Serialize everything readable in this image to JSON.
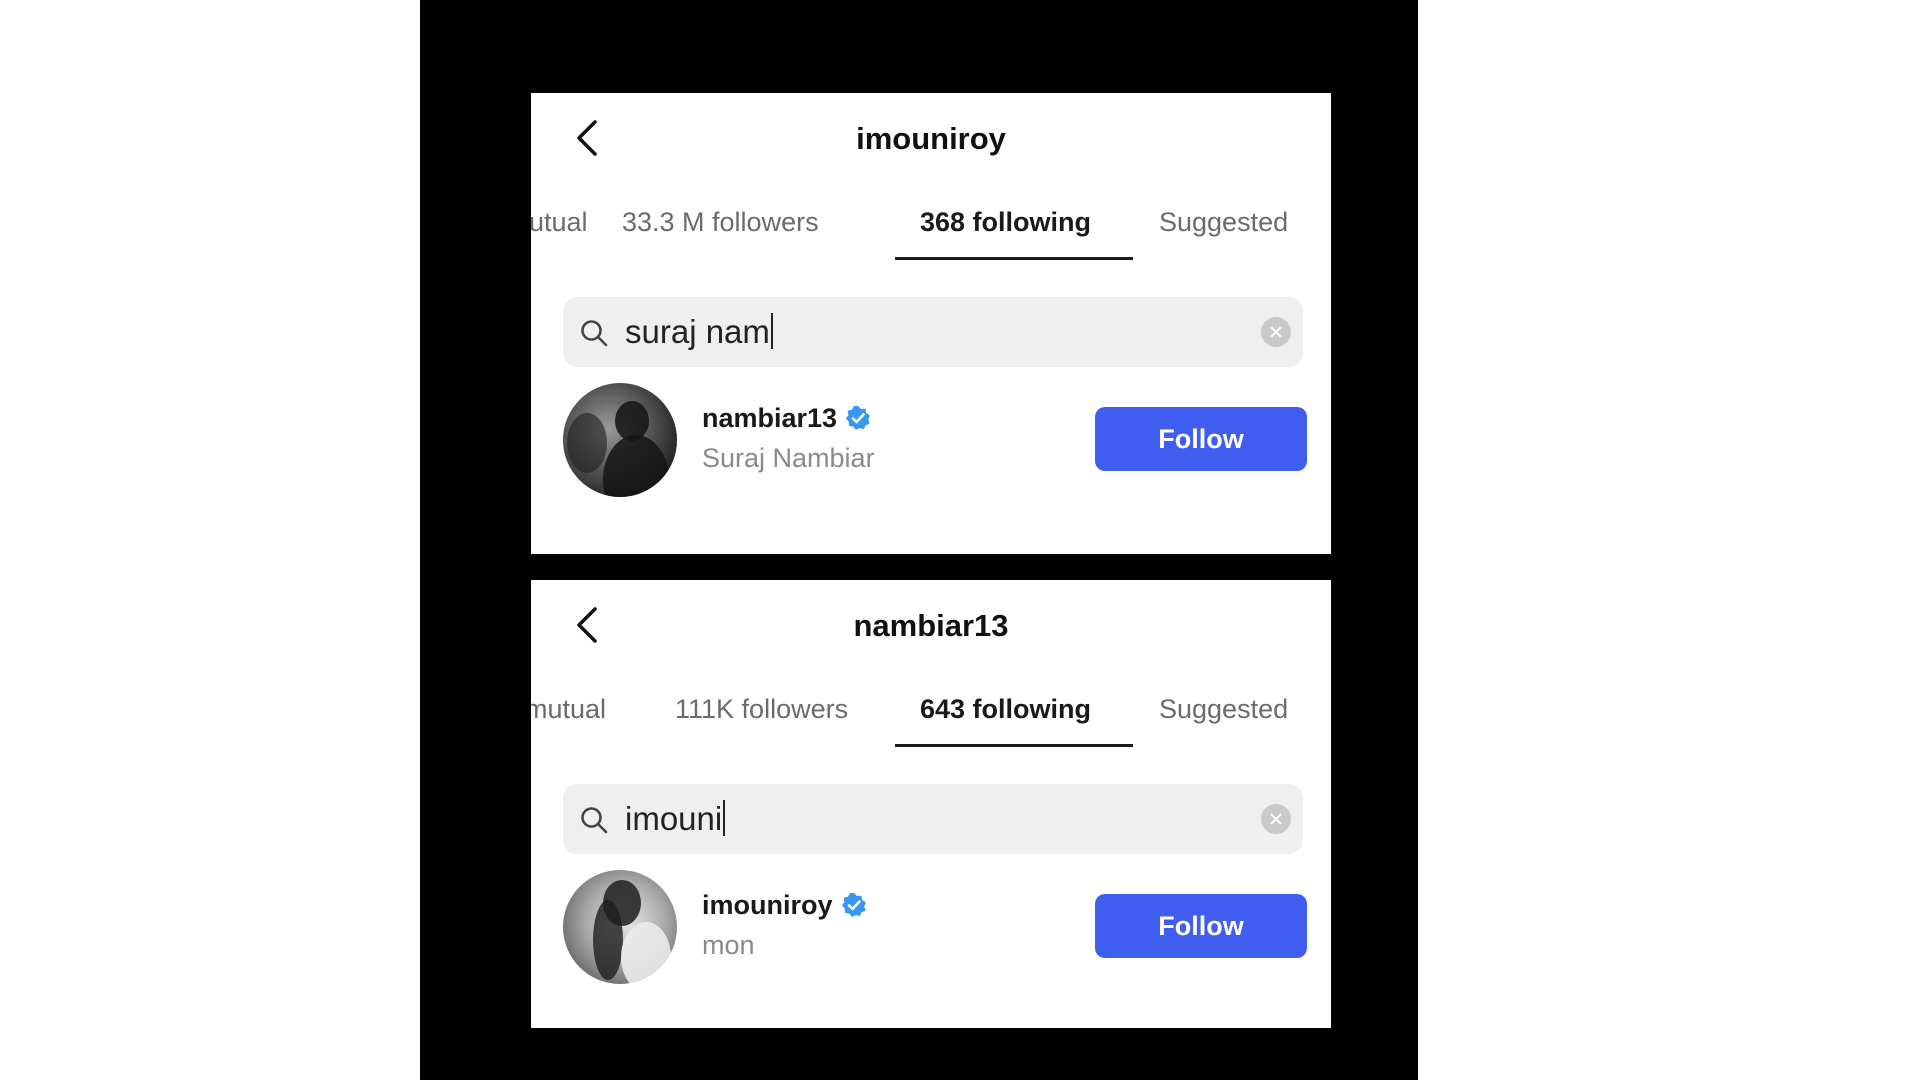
{
  "panels": [
    {
      "title": "imouniroy",
      "tabs": [
        {
          "label": "utual"
        },
        {
          "label": "33.3 M followers"
        },
        {
          "label": "368 following",
          "active": true
        },
        {
          "label": "Suggested"
        }
      ],
      "search": {
        "value": "suraj nam"
      },
      "result": {
        "username": "nambiar13",
        "full_name": "Suraj Nambiar",
        "verified": true,
        "button_label": "Follow"
      }
    },
    {
      "title": "nambiar13",
      "tabs": [
        {
          "label": "mutual"
        },
        {
          "label": "111K followers"
        },
        {
          "label": "643 following",
          "active": true
        },
        {
          "label": "Suggested"
        }
      ],
      "search": {
        "value": "imouni"
      },
      "result": {
        "username": "imouniroy",
        "full_name": "mon",
        "verified": true,
        "button_label": "Follow"
      }
    }
  ],
  "colors": {
    "follow_button": "#3f5ef0",
    "verified_badge": "#3897f0",
    "search_background": "#efefef",
    "backdrop": "#000000"
  },
  "icons": [
    "back-arrow-icon",
    "search-icon",
    "clear-search-icon",
    "verified-badge-icon"
  ]
}
